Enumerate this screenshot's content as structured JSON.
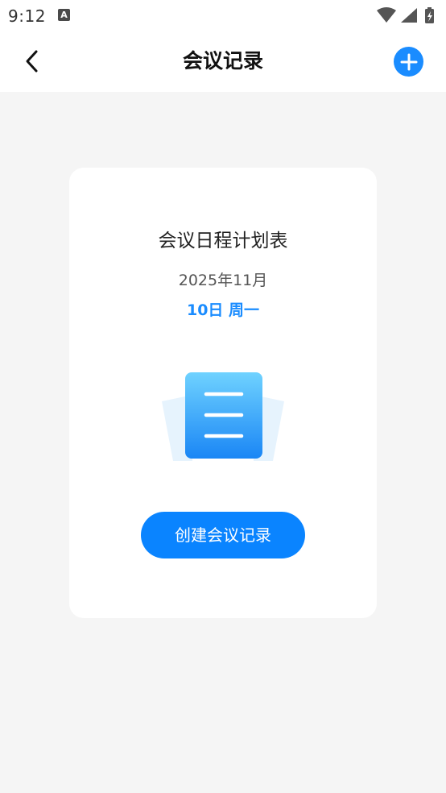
{
  "status_bar": {
    "time": "9:12",
    "notification_icon": "A"
  },
  "header": {
    "title": "会议记录",
    "back_icon": "chevron-left-icon",
    "add_icon": "plus-circle-icon"
  },
  "card": {
    "title": "会议日程计划表",
    "month": "2025年11月",
    "day": "10日  周一",
    "illustration_icon": "document-icon",
    "create_button_label": "创建会议记录"
  },
  "colors": {
    "accent": "#1a8cff",
    "background": "#f5f5f5",
    "card": "#ffffff"
  }
}
